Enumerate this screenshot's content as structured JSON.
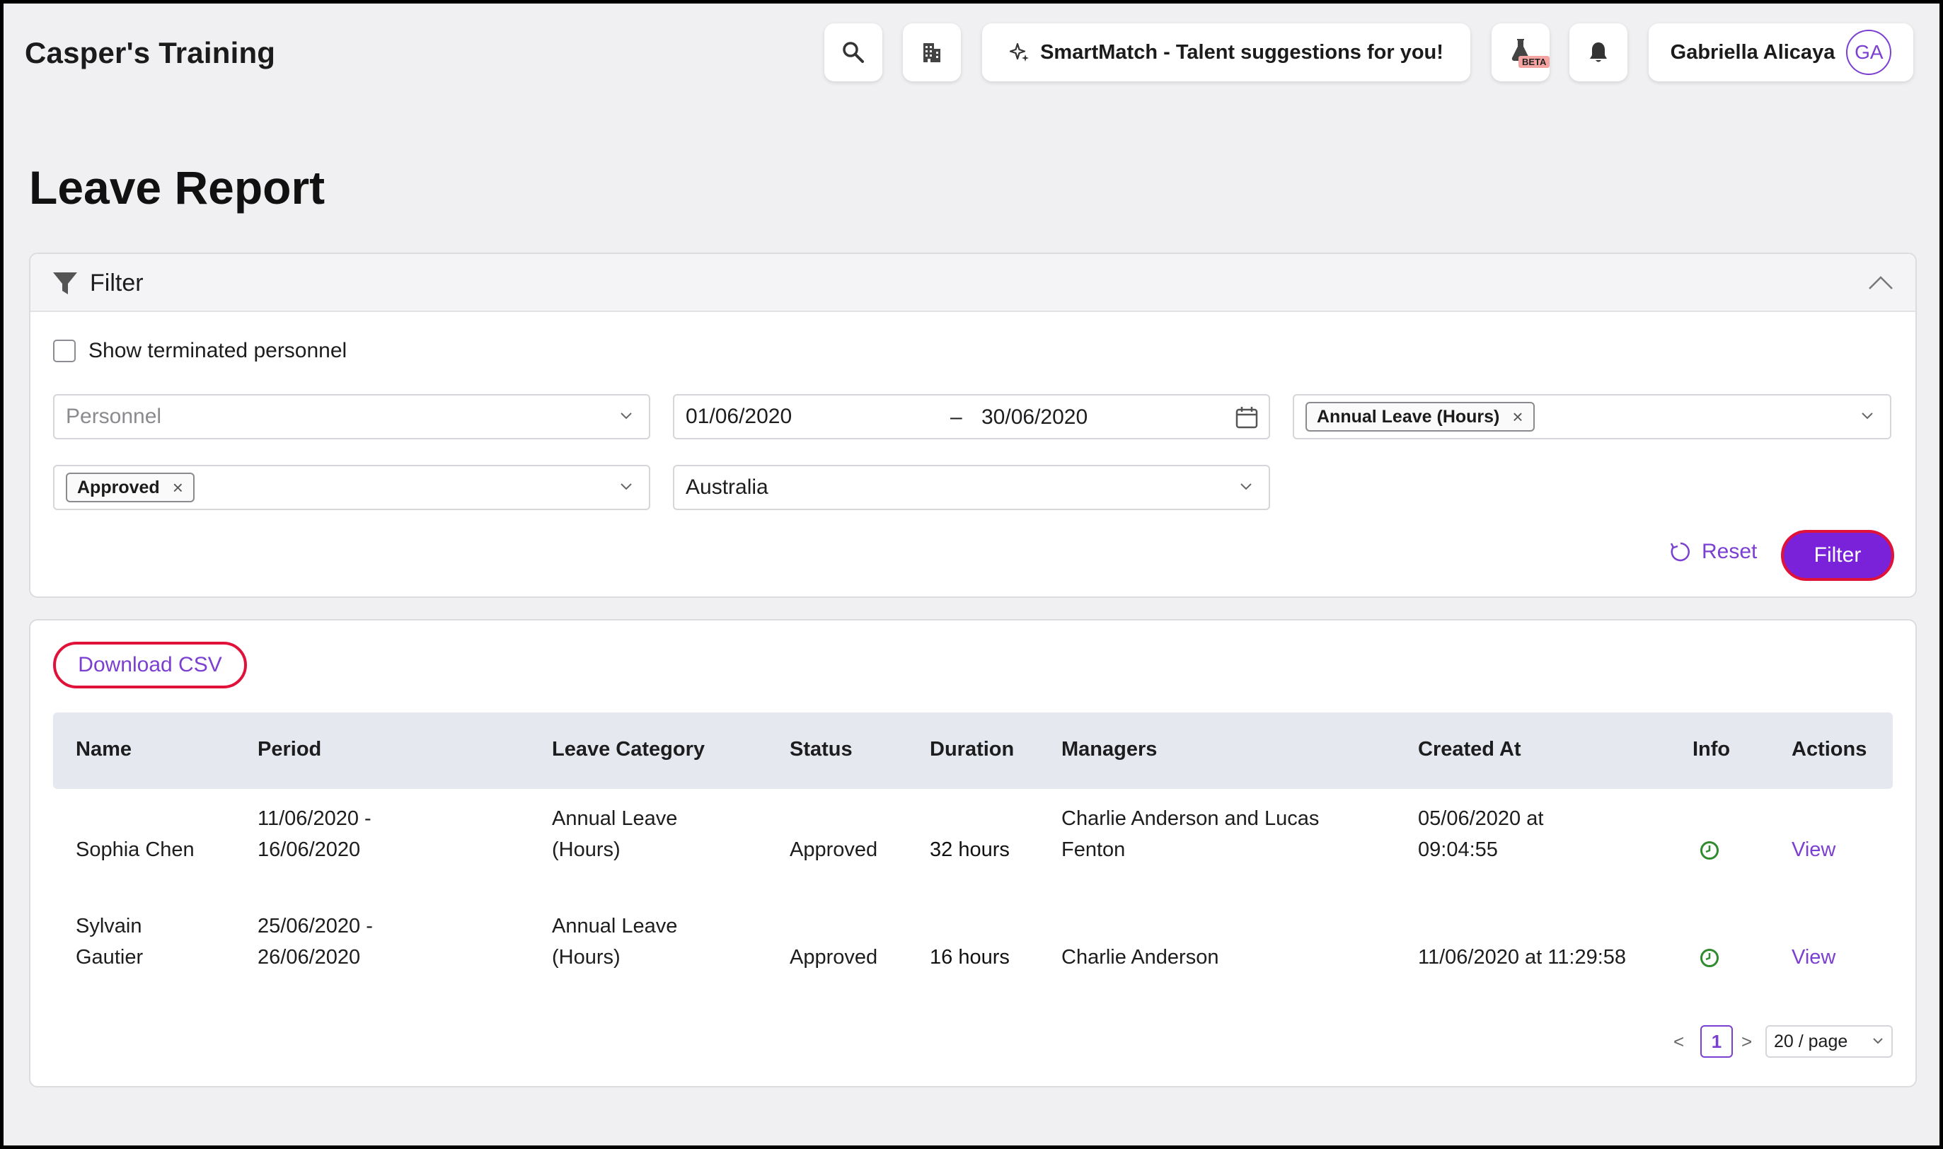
{
  "app": {
    "title": "Casper's Training"
  },
  "topbar": {
    "smartmatch_label": "SmartMatch - Talent suggestions for you!",
    "beta_label": "BETA",
    "user_name": "Gabriella Alicaya",
    "user_initials": "GA",
    "icons": [
      "search-icon",
      "building-icon",
      "sparkle-icon",
      "flask-icon",
      "bell-icon"
    ]
  },
  "page": {
    "title": "Leave Report"
  },
  "filter": {
    "title": "Filter",
    "show_terminated_label": "Show terminated personnel",
    "show_terminated_checked": false,
    "personnel_placeholder": "Personnel",
    "date_start": "01/06/2020",
    "date_sep": "–",
    "date_end": "30/06/2020",
    "leave_category_tag": "Annual Leave (Hours)",
    "status_tag": "Approved",
    "country_value": "Australia",
    "reset_label": "Reset",
    "filter_label": "Filter"
  },
  "results": {
    "download_label": "Download CSV",
    "columns": [
      "Name",
      "Period",
      "Leave Category",
      "Status",
      "Duration",
      "Managers",
      "Created At",
      "Info",
      "Actions"
    ],
    "rows": [
      {
        "name": "Sophia Chen",
        "period": "11/06/2020 - 16/06/2020",
        "category": "Annual Leave (Hours)",
        "status": "Approved",
        "duration": "32 hours",
        "managers": "Charlie Anderson and Lucas Fenton",
        "created_at": "05/06/2020 at 09:04:55",
        "action": "View"
      },
      {
        "name": "Sylvain Gautier",
        "period": "25/06/2020 - 26/06/2020",
        "category": "Annual Leave (Hours)",
        "status": "Approved",
        "duration": "16 hours",
        "managers": "Charlie Anderson",
        "created_at": "11/06/2020 at 11:29:58",
        "action": "View"
      }
    ],
    "pagination": {
      "prev": "<",
      "current_page": "1",
      "next": ">",
      "page_size": "20 / page"
    }
  },
  "colors": {
    "accent": "#7a22d9",
    "highlight_border": "#e0123a",
    "info_green": "#2e8b2e"
  }
}
